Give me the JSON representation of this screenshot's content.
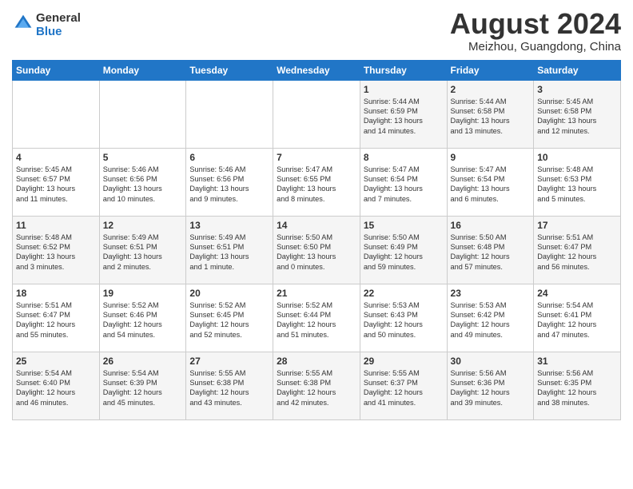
{
  "header": {
    "logo_line1": "General",
    "logo_line2": "Blue",
    "month": "August 2024",
    "location": "Meizhou, Guangdong, China"
  },
  "days_of_week": [
    "Sunday",
    "Monday",
    "Tuesday",
    "Wednesday",
    "Thursday",
    "Friday",
    "Saturday"
  ],
  "weeks": [
    [
      {
        "num": "",
        "info": ""
      },
      {
        "num": "",
        "info": ""
      },
      {
        "num": "",
        "info": ""
      },
      {
        "num": "",
        "info": ""
      },
      {
        "num": "1",
        "info": "Sunrise: 5:44 AM\nSunset: 6:59 PM\nDaylight: 13 hours\nand 14 minutes."
      },
      {
        "num": "2",
        "info": "Sunrise: 5:44 AM\nSunset: 6:58 PM\nDaylight: 13 hours\nand 13 minutes."
      },
      {
        "num": "3",
        "info": "Sunrise: 5:45 AM\nSunset: 6:58 PM\nDaylight: 13 hours\nand 12 minutes."
      }
    ],
    [
      {
        "num": "4",
        "info": "Sunrise: 5:45 AM\nSunset: 6:57 PM\nDaylight: 13 hours\nand 11 minutes."
      },
      {
        "num": "5",
        "info": "Sunrise: 5:46 AM\nSunset: 6:56 PM\nDaylight: 13 hours\nand 10 minutes."
      },
      {
        "num": "6",
        "info": "Sunrise: 5:46 AM\nSunset: 6:56 PM\nDaylight: 13 hours\nand 9 minutes."
      },
      {
        "num": "7",
        "info": "Sunrise: 5:47 AM\nSunset: 6:55 PM\nDaylight: 13 hours\nand 8 minutes."
      },
      {
        "num": "8",
        "info": "Sunrise: 5:47 AM\nSunset: 6:54 PM\nDaylight: 13 hours\nand 7 minutes."
      },
      {
        "num": "9",
        "info": "Sunrise: 5:47 AM\nSunset: 6:54 PM\nDaylight: 13 hours\nand 6 minutes."
      },
      {
        "num": "10",
        "info": "Sunrise: 5:48 AM\nSunset: 6:53 PM\nDaylight: 13 hours\nand 5 minutes."
      }
    ],
    [
      {
        "num": "11",
        "info": "Sunrise: 5:48 AM\nSunset: 6:52 PM\nDaylight: 13 hours\nand 3 minutes."
      },
      {
        "num": "12",
        "info": "Sunrise: 5:49 AM\nSunset: 6:51 PM\nDaylight: 13 hours\nand 2 minutes."
      },
      {
        "num": "13",
        "info": "Sunrise: 5:49 AM\nSunset: 6:51 PM\nDaylight: 13 hours\nand 1 minute."
      },
      {
        "num": "14",
        "info": "Sunrise: 5:50 AM\nSunset: 6:50 PM\nDaylight: 13 hours\nand 0 minutes."
      },
      {
        "num": "15",
        "info": "Sunrise: 5:50 AM\nSunset: 6:49 PM\nDaylight: 12 hours\nand 59 minutes."
      },
      {
        "num": "16",
        "info": "Sunrise: 5:50 AM\nSunset: 6:48 PM\nDaylight: 12 hours\nand 57 minutes."
      },
      {
        "num": "17",
        "info": "Sunrise: 5:51 AM\nSunset: 6:47 PM\nDaylight: 12 hours\nand 56 minutes."
      }
    ],
    [
      {
        "num": "18",
        "info": "Sunrise: 5:51 AM\nSunset: 6:47 PM\nDaylight: 12 hours\nand 55 minutes."
      },
      {
        "num": "19",
        "info": "Sunrise: 5:52 AM\nSunset: 6:46 PM\nDaylight: 12 hours\nand 54 minutes."
      },
      {
        "num": "20",
        "info": "Sunrise: 5:52 AM\nSunset: 6:45 PM\nDaylight: 12 hours\nand 52 minutes."
      },
      {
        "num": "21",
        "info": "Sunrise: 5:52 AM\nSunset: 6:44 PM\nDaylight: 12 hours\nand 51 minutes."
      },
      {
        "num": "22",
        "info": "Sunrise: 5:53 AM\nSunset: 6:43 PM\nDaylight: 12 hours\nand 50 minutes."
      },
      {
        "num": "23",
        "info": "Sunrise: 5:53 AM\nSunset: 6:42 PM\nDaylight: 12 hours\nand 49 minutes."
      },
      {
        "num": "24",
        "info": "Sunrise: 5:54 AM\nSunset: 6:41 PM\nDaylight: 12 hours\nand 47 minutes."
      }
    ],
    [
      {
        "num": "25",
        "info": "Sunrise: 5:54 AM\nSunset: 6:40 PM\nDaylight: 12 hours\nand 46 minutes."
      },
      {
        "num": "26",
        "info": "Sunrise: 5:54 AM\nSunset: 6:39 PM\nDaylight: 12 hours\nand 45 minutes."
      },
      {
        "num": "27",
        "info": "Sunrise: 5:55 AM\nSunset: 6:38 PM\nDaylight: 12 hours\nand 43 minutes."
      },
      {
        "num": "28",
        "info": "Sunrise: 5:55 AM\nSunset: 6:38 PM\nDaylight: 12 hours\nand 42 minutes."
      },
      {
        "num": "29",
        "info": "Sunrise: 5:55 AM\nSunset: 6:37 PM\nDaylight: 12 hours\nand 41 minutes."
      },
      {
        "num": "30",
        "info": "Sunrise: 5:56 AM\nSunset: 6:36 PM\nDaylight: 12 hours\nand 39 minutes."
      },
      {
        "num": "31",
        "info": "Sunrise: 5:56 AM\nSunset: 6:35 PM\nDaylight: 12 hours\nand 38 minutes."
      }
    ]
  ]
}
